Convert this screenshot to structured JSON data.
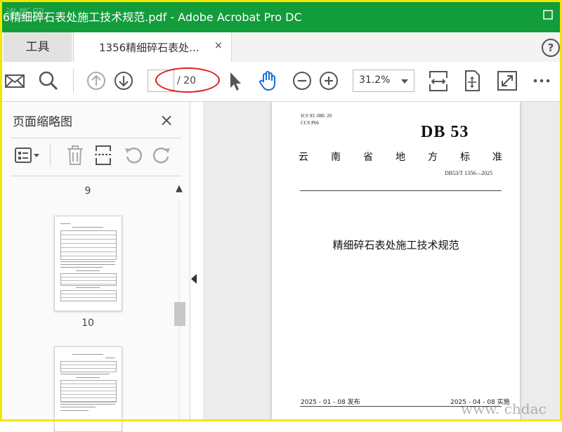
{
  "window": {
    "title": "6精细碎石表处施工技术规范.pdf - Adobe Acrobat Pro DC",
    "watermark_logo": "洛斯网",
    "minimize_symbol": "—",
    "maximize_symbol": "☐"
  },
  "tabs": {
    "tools_label": "工具",
    "doc_label": "1356精细碎石表处...",
    "doc_close": "×",
    "help": "?"
  },
  "toolbar": {
    "page_current": "",
    "page_total": "/ 20",
    "zoom": "31.2%"
  },
  "panel": {
    "title": "页面缩略图",
    "close": "×",
    "page_nums": [
      "9",
      "10"
    ],
    "scroll_up": "▲"
  },
  "document": {
    "ics": "ICS  93. 080. 20",
    "ccs": "CCS  P66",
    "logo": "DB 53",
    "province_chars": [
      "云",
      "南",
      "省",
      "地",
      "方",
      "标",
      "准"
    ],
    "doc_number": "DB53/T  1356—2025",
    "title": "精细碎石表处施工技术规范",
    "release": "2025 - 01 - 08 发布",
    "implement": "2025 - 04 - 08 实施"
  },
  "site_watermark": "www. chdac",
  "colors": {
    "titlebar": "#139c3a",
    "frame": "#f2e700",
    "annotation": "#e11b1b",
    "hand_tool": "#1a6fd6"
  }
}
